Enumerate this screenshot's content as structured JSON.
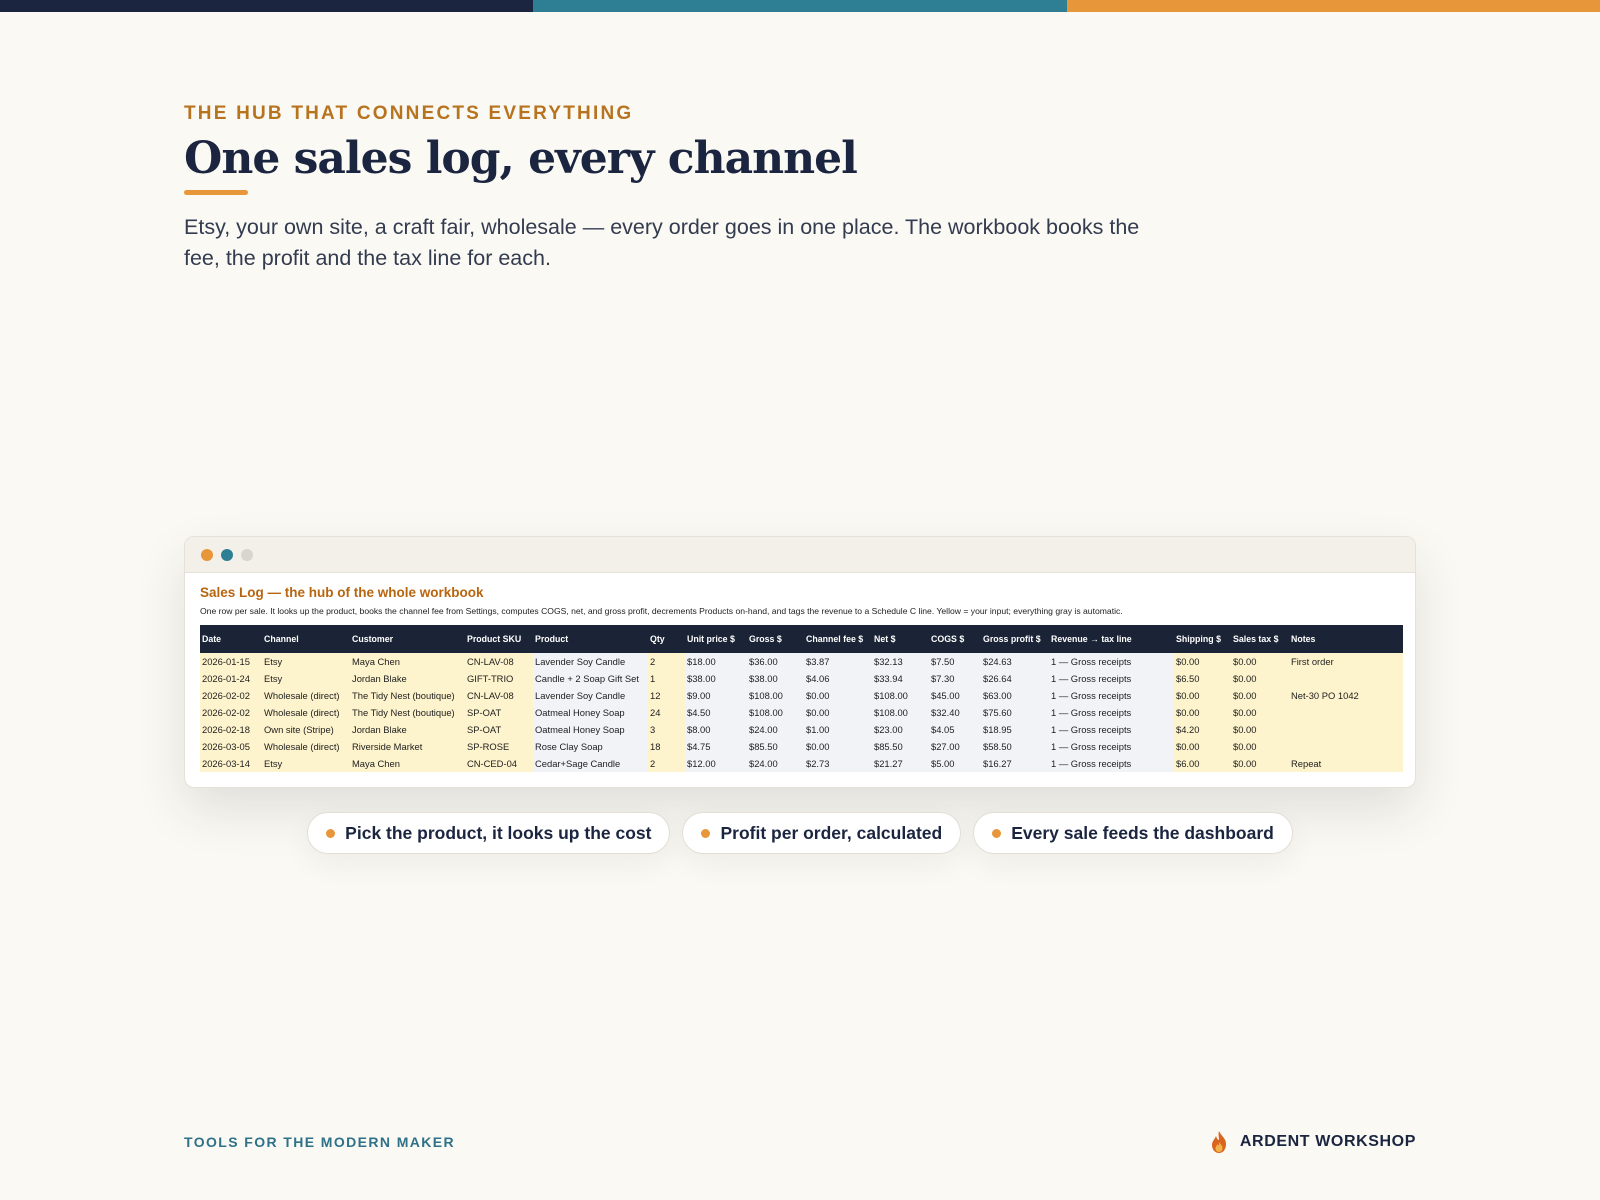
{
  "colors": {
    "navy": "#1b2540",
    "teal": "#2e7f93",
    "orange": "#e8963a",
    "eyebrow": "#b8731f",
    "sheet_title": "#b8650f",
    "footer_teal": "#2e7189",
    "dot_gray": "#d8d5cf"
  },
  "topbar": [
    "#1b2540",
    "#2e7f93",
    "#e8963a"
  ],
  "hero": {
    "eyebrow": "THE HUB THAT CONNECTS EVERYTHING",
    "title": "One sales log, every channel",
    "lede": "Etsy, your own site, a craft fair, wholesale — every order goes in one place. The workbook books the fee, the profit and the tax line for each."
  },
  "sheet": {
    "title": "Sales Log — the hub of the whole workbook",
    "description": "One row per sale. It looks up the product, books the channel fee from Settings, computes COGS, net, and gross profit, decrements Products on-hand, and tags the revenue to a Schedule C line. Yellow = your input; everything gray is automatic.",
    "columns": [
      "Date",
      "Channel",
      "Customer",
      "Product SKU",
      "Product",
      "Qty",
      "Unit price $",
      "Gross $",
      "Channel fee $",
      "Net $",
      "COGS $",
      "Gross profit $",
      "Revenue → tax line",
      "Shipping $",
      "Sales tax $",
      "Notes"
    ],
    "rows": [
      [
        "2026-01-15",
        "Etsy",
        "Maya Chen",
        "CN-LAV-08",
        "Lavender Soy Candle",
        "2",
        "$18.00",
        "$36.00",
        "$3.87",
        "$32.13",
        "$7.50",
        "$24.63",
        "1 — Gross receipts",
        "$0.00",
        "$0.00",
        "First order"
      ],
      [
        "2026-01-24",
        "Etsy",
        "Jordan Blake",
        "GIFT-TRIO",
        "Candle + 2 Soap Gift Set",
        "1",
        "$38.00",
        "$38.00",
        "$4.06",
        "$33.94",
        "$7.30",
        "$26.64",
        "1 — Gross receipts",
        "$6.50",
        "$0.00",
        ""
      ],
      [
        "2026-02-02",
        "Wholesale (direct)",
        "The Tidy Nest (boutique)",
        "CN-LAV-08",
        "Lavender Soy Candle",
        "12",
        "$9.00",
        "$108.00",
        "$0.00",
        "$108.00",
        "$45.00",
        "$63.00",
        "1 — Gross receipts",
        "$0.00",
        "$0.00",
        "Net-30 PO 1042"
      ],
      [
        "2026-02-02",
        "Wholesale (direct)",
        "The Tidy Nest (boutique)",
        "SP-OAT",
        "Oatmeal Honey Soap",
        "24",
        "$4.50",
        "$108.00",
        "$0.00",
        "$108.00",
        "$32.40",
        "$75.60",
        "1 — Gross receipts",
        "$0.00",
        "$0.00",
        ""
      ],
      [
        "2026-02-18",
        "Own site (Stripe)",
        "Jordan Blake",
        "SP-OAT",
        "Oatmeal Honey Soap",
        "3",
        "$8.00",
        "$24.00",
        "$1.00",
        "$23.00",
        "$4.05",
        "$18.95",
        "1 — Gross receipts",
        "$4.20",
        "$0.00",
        ""
      ],
      [
        "2026-03-05",
        "Wholesale (direct)",
        "Riverside Market",
        "SP-ROSE",
        "Rose Clay Soap",
        "18",
        "$4.75",
        "$85.50",
        "$0.00",
        "$85.50",
        "$27.00",
        "$58.50",
        "1 — Gross receipts",
        "$0.00",
        "$0.00",
        ""
      ],
      [
        "2026-03-14",
        "Etsy",
        "Maya Chen",
        "CN-CED-04",
        "Cedar+Sage Candle",
        "2",
        "$12.00",
        "$24.00",
        "$2.73",
        "$21.27",
        "$5.00",
        "$16.27",
        "1 — Gross receipts",
        "$6.00",
        "$0.00",
        "Repeat"
      ]
    ],
    "column_kind": [
      "inp",
      "inp",
      "inp",
      "inp",
      "calc",
      "inp",
      "calc",
      "calc",
      "calc",
      "calc",
      "calc",
      "calc",
      "calc",
      "inp",
      "inp",
      "inp"
    ]
  },
  "chips": [
    "Pick the product, it looks up the cost",
    "Profit per order, calculated",
    "Every sale feeds the dashboard"
  ],
  "footer": {
    "tagline": "TOOLS FOR THE MODERN MAKER",
    "brand": "ARDENT WORKSHOP",
    "brand_icon": "flame-icon"
  }
}
